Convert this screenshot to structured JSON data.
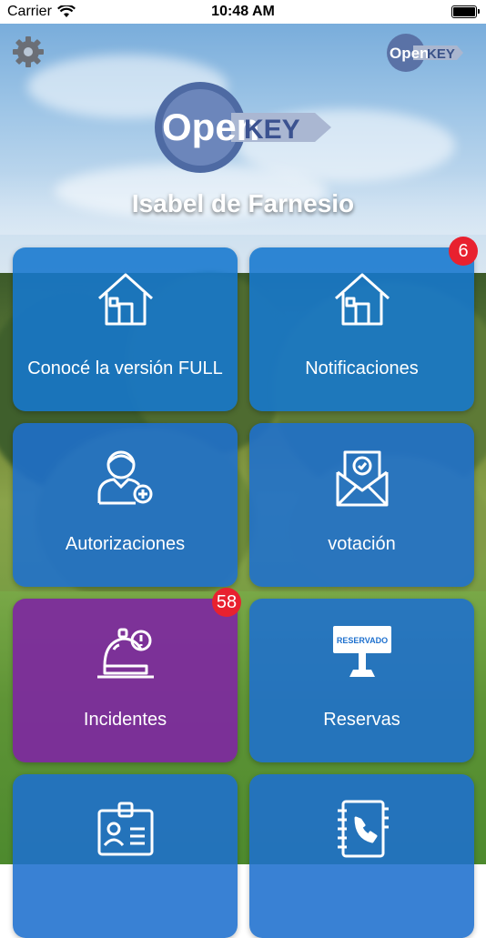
{
  "status_bar": {
    "carrier": "Carrier",
    "time": "10:48 AM"
  },
  "header": {
    "logo_text_open": "Open",
    "logo_text_key": "KEY",
    "user_name": "Isabel de Farnesio"
  },
  "colors": {
    "tile_blue": "#1678ce",
    "tile_purple": "#7e28a0",
    "badge_red": "#e8212f"
  },
  "tiles": [
    {
      "label": "Conocé la versión FULL",
      "icon": "house-icon"
    },
    {
      "label": "Notificaciones",
      "icon": "house-icon",
      "badge": "6"
    },
    {
      "label": "Autorizaciones",
      "icon": "user-add-icon"
    },
    {
      "label": "votación",
      "icon": "vote-envelope-icon"
    },
    {
      "label": "Incidentes",
      "icon": "alert-bell-icon",
      "badge": "58"
    },
    {
      "label": "Reservas",
      "icon": "reserved-sign-icon",
      "sign_text": "RESERVADO"
    },
    {
      "label": "",
      "icon": "id-badge-icon"
    },
    {
      "label": "",
      "icon": "phone-book-icon"
    }
  ]
}
